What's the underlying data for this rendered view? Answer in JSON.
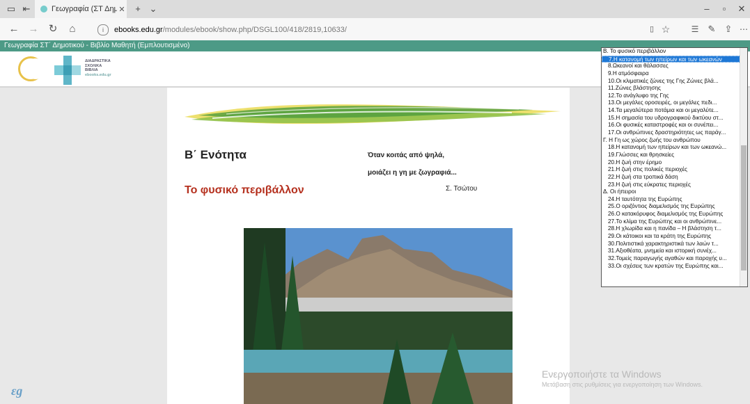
{
  "browser": {
    "tab_title": "Γεωγραφία (ΣΤ Δημοτικ",
    "url_host": "ebooks.edu.gr",
    "url_path": "/modules/ebook/show.php/DSGL100/418/2819,10633/"
  },
  "app": {
    "header_title": "Γεωγραφία ΣΤ΄ Δημοτικού - Βιβλίο Μαθητή (Εμπλουτισμένο)",
    "logo_text": [
      "ΔΙΑΔΡΑΣΤΙΚΑ",
      "ΣΧΟΛΙΚΑ",
      "ΒΙΒΛΙΑ",
      "ebooks.edu.gr"
    ]
  },
  "page": {
    "unit_title": "Β΄ Ενότητα",
    "chapter_title": "Το φυσικό περιβάλλον",
    "poem_line1": "Όταν κοιτάς από ψηλά,",
    "poem_line2": "μοιάζει η γη με ζωγραφιά...",
    "poem_author": "Σ. Τσώτου"
  },
  "footer": {
    "logo": "εg",
    "watermark_title": "Ενεργοποιήστε τα Windows",
    "watermark_sub": "Μετάβαση στις ρυθμίσεις για ενεργοποίηση των Windows."
  },
  "toc": {
    "items": [
      {
        "label": "Β. Το φυσικό περιβάλλον",
        "group": true
      },
      {
        "label": "7.Η κατανομή των ηπείρων και των ωκεανών",
        "selected": true
      },
      {
        "label": "8.Ωκεανοί και θάλασσες"
      },
      {
        "label": "9.Η ατμόσφαιρα"
      },
      {
        "label": "10.Οι κλιματικές ζώνες της Γης Ζώνες βλά..."
      },
      {
        "label": "11.Ζώνες βλάστησης"
      },
      {
        "label": "12.Το ανάγλυφο της Γης"
      },
      {
        "label": "13.Οι μεγάλες οροσειρές, οι μεγάλες πεδι..."
      },
      {
        "label": "14.Τα μεγαλύτερα ποτάμια και οι μεγαλύτε..."
      },
      {
        "label": "15.Η σημασία του υδρογραφικού δικτύου στ..."
      },
      {
        "label": "16.Οι φυσικές καταστροφές και οι συνέπει..."
      },
      {
        "label": "17.Οι ανθρώπινες δραστηριότητες ως παράγ..."
      },
      {
        "label": "Γ. Η Γη ως χώρος ζωής του ανθρώπου",
        "group": true
      },
      {
        "label": "18.Η κατανομή των ηπείρων και των ωκεανώ..."
      },
      {
        "label": "19.Γλώσσες και θρησκείες"
      },
      {
        "label": "20.Η ζωή στην έρημο"
      },
      {
        "label": "21.Η ζωή στις πολικές περιοχές"
      },
      {
        "label": "22.Η ζωή στα τροπικά δάση"
      },
      {
        "label": "23.Η ζωή στις εύκρατες περιοχές"
      },
      {
        "label": "Δ. Οι ήπειροι",
        "group": true
      },
      {
        "label": "24.Η ταυτότητα της Ευρώπης"
      },
      {
        "label": "25.Ο οριζόντιος διαμελισμός της Ευρώπης"
      },
      {
        "label": "26.Ο κατακόρυφος διαμελισμός της Ευρώπης"
      },
      {
        "label": "27.Το κλίμα της Ευρώπης και οι ανθρώπινε..."
      },
      {
        "label": "28.Η χλωρίδα και η πανίδα – Η βλάστηση τ..."
      },
      {
        "label": "29.Οι κάτοικοι και τα κράτη της Ευρώπης"
      },
      {
        "label": "30.Πολιτιστικά χαρακτηριστικά των λαών τ..."
      },
      {
        "label": "31.Αξιοθέατα, μνημεία και ιστορική συνέχ..."
      },
      {
        "label": "32.Τομείς παραγωγής αγαθών και παροχής υ..."
      },
      {
        "label": "33.Οι σχέσεις των κρατών της Ευρώπης και..."
      }
    ]
  }
}
